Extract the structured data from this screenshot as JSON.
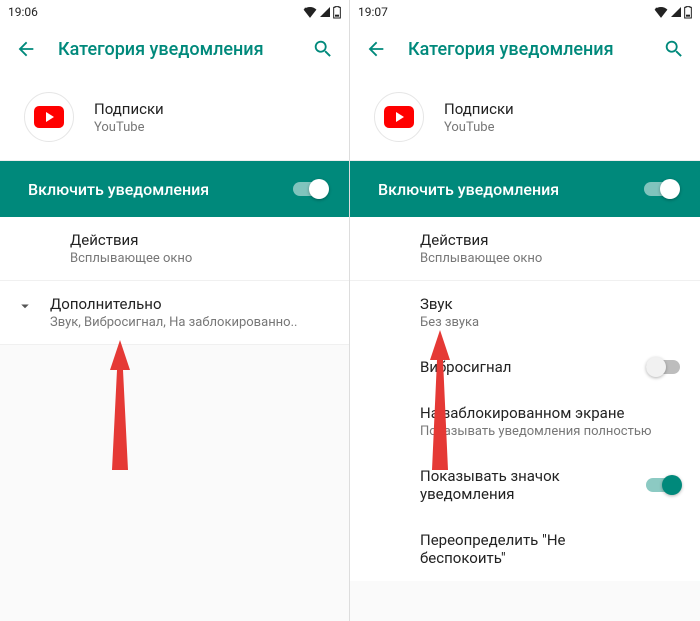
{
  "left": {
    "status": {
      "time": "19:06"
    },
    "appbar": {
      "title": "Категория уведомления"
    },
    "header": {
      "title": "Подписки",
      "subtitle": "YouTube"
    },
    "enable": {
      "label": "Включить уведомления"
    },
    "action": {
      "title": "Действия",
      "subtitle": "Всплывающее окно"
    },
    "more": {
      "title": "Дополнительно",
      "subtitle": "Звук, Вибросигнал, На заблокированно.."
    }
  },
  "right": {
    "status": {
      "time": "19:07"
    },
    "appbar": {
      "title": "Категория уведомления"
    },
    "header": {
      "title": "Подписки",
      "subtitle": "YouTube"
    },
    "enable": {
      "label": "Включить уведомления"
    },
    "action": {
      "title": "Действия",
      "subtitle": "Всплывающее окно"
    },
    "sound": {
      "title": "Звук",
      "subtitle": "Без звука"
    },
    "vibrate": {
      "title": "Вибросигнал"
    },
    "lock": {
      "title": "На заблокированном экране",
      "subtitle": "Показывать уведомления полностью"
    },
    "badge": {
      "title": "Показывать значок уведомления"
    },
    "dnd": {
      "title": "Переопределить \"Не беспокоить\""
    }
  }
}
